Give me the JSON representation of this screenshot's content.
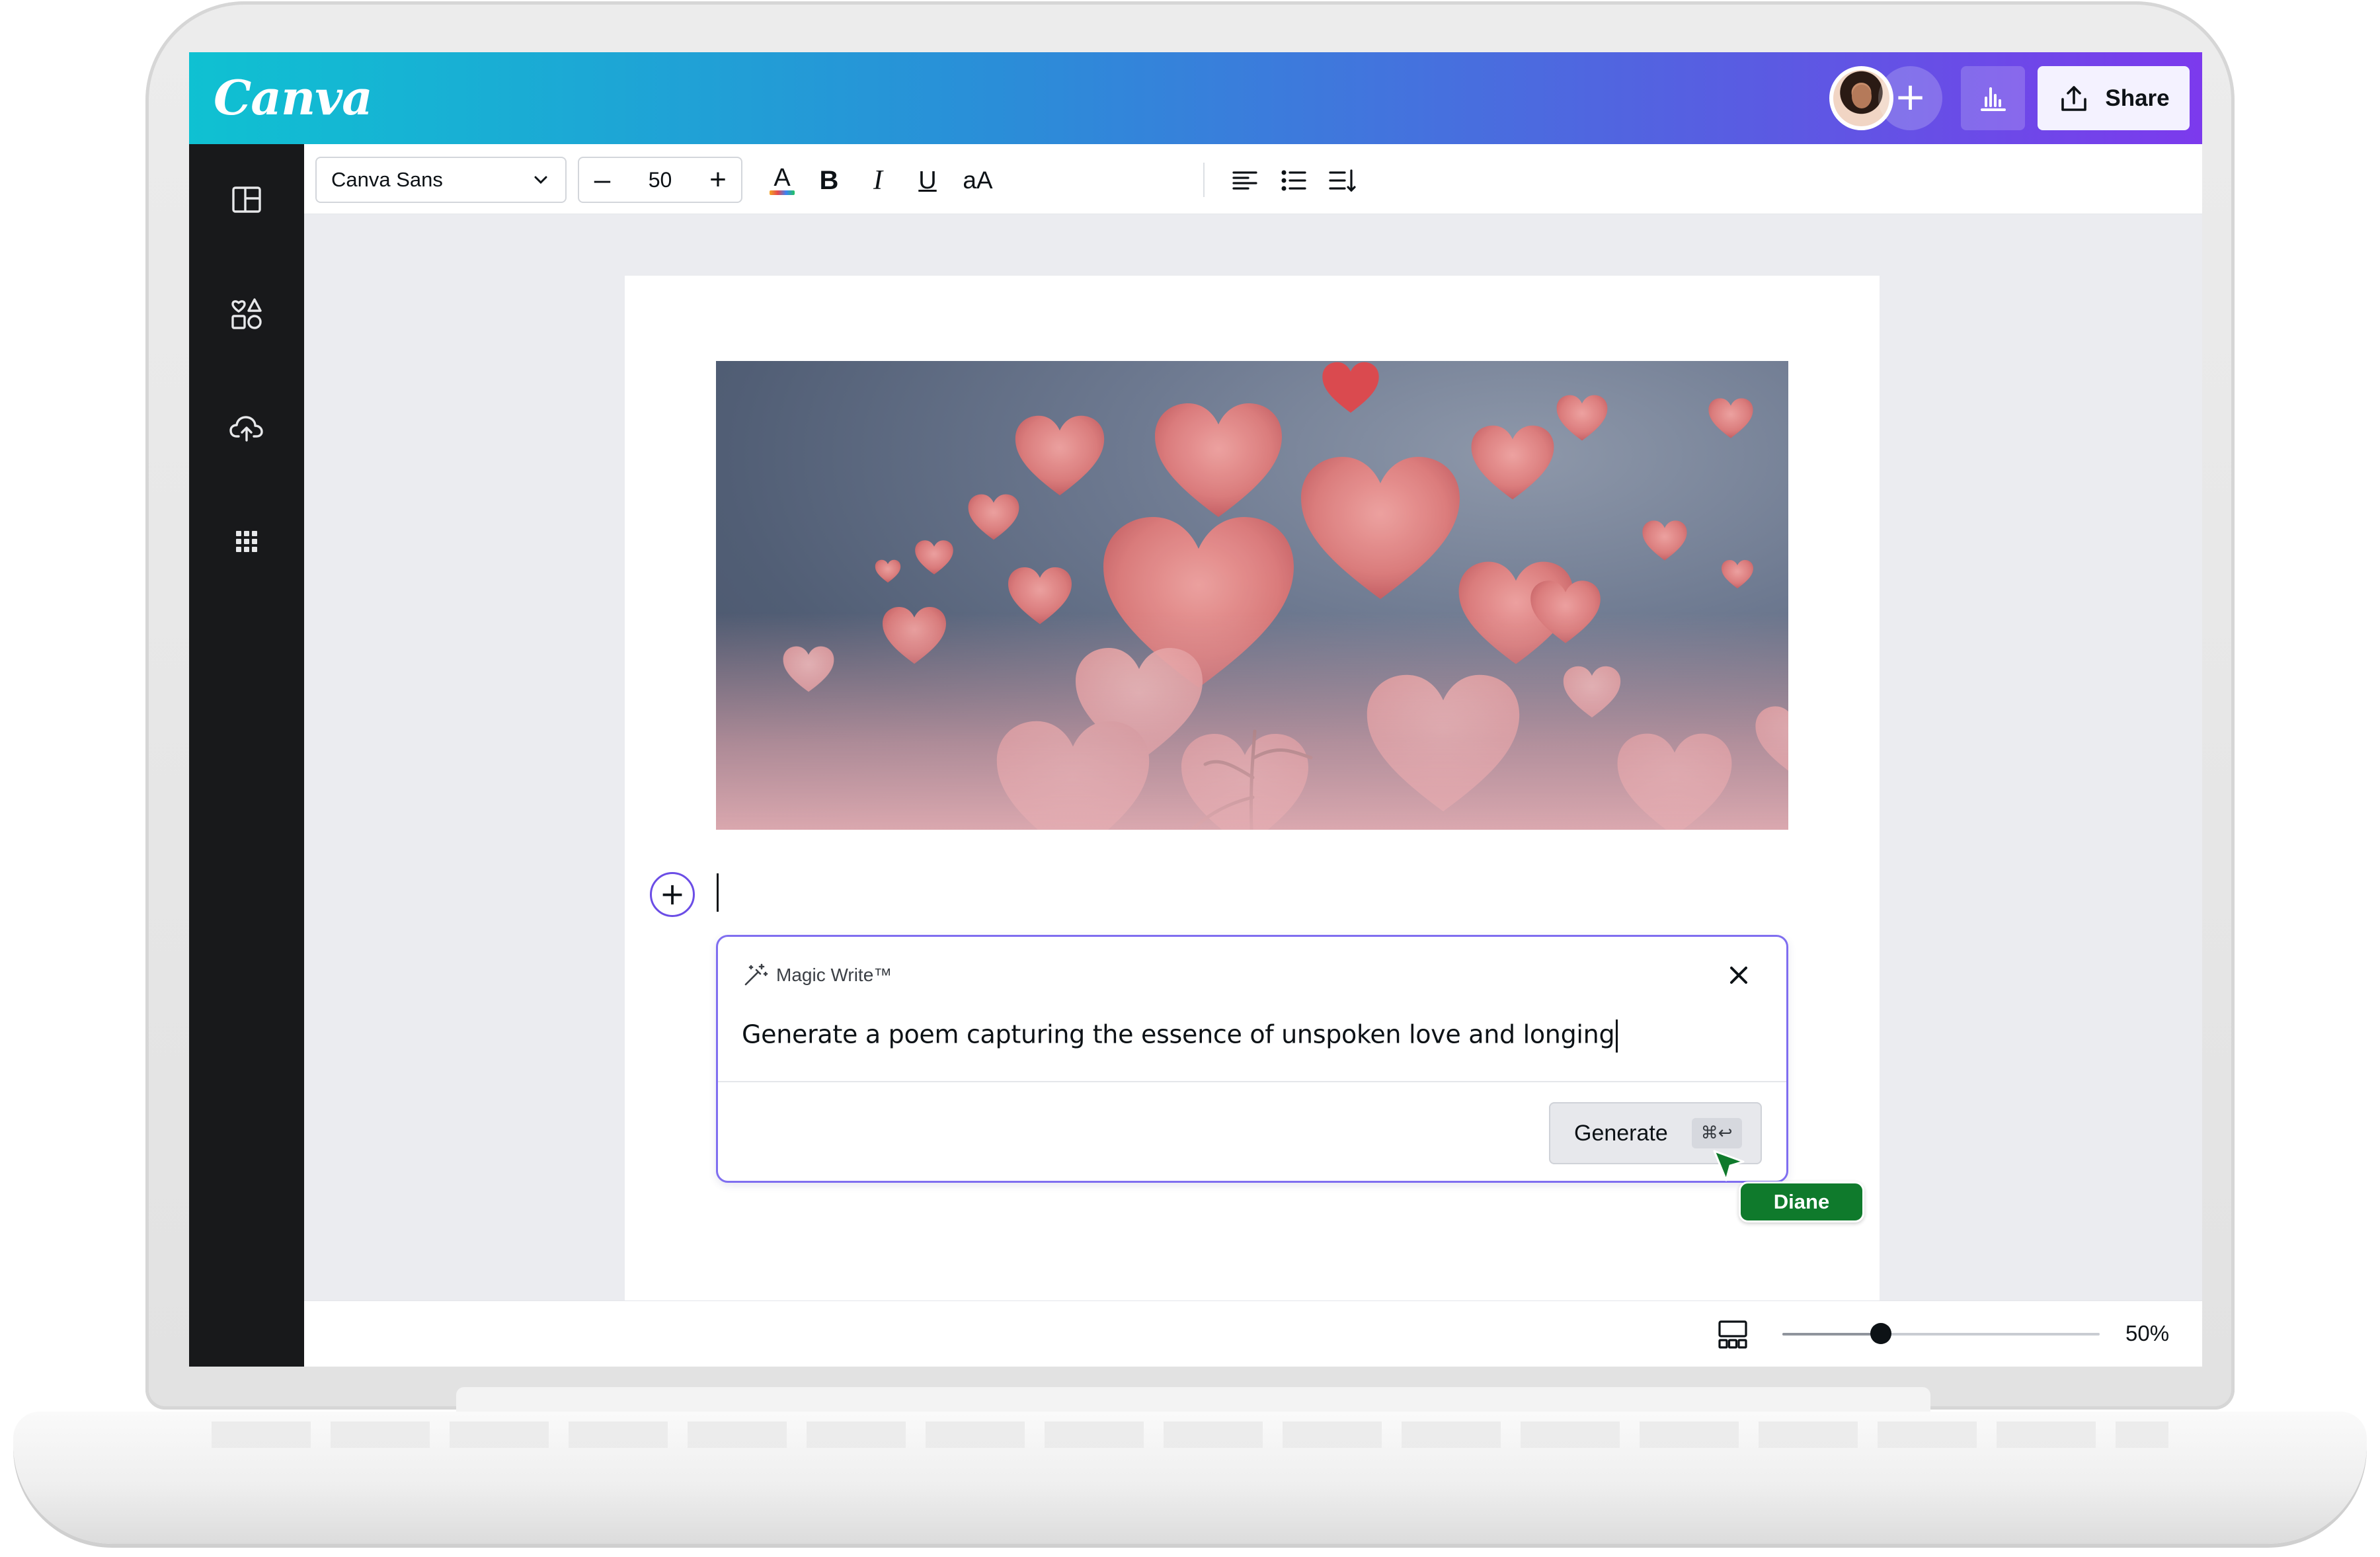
{
  "app": {
    "logo_text": "Canva"
  },
  "topbar": {
    "avatar_icon": "user-avatar",
    "add_icon": "plus-icon",
    "analytics_icon": "bar-chart-icon",
    "share_label": "Share",
    "share_icon": "upload-icon"
  },
  "sidebar": {
    "items": [
      {
        "name": "design",
        "icon": "layout-icon"
      },
      {
        "name": "elements",
        "icon": "shapes-icon"
      },
      {
        "name": "uploads",
        "icon": "cloud-upload-icon"
      },
      {
        "name": "apps",
        "icon": "grid-icon"
      }
    ]
  },
  "toolbar": {
    "font_family": "Canva Sans",
    "font_size": "50",
    "decrease": "–",
    "increase": "+",
    "text_color_glyph": "A",
    "bold_glyph": "B",
    "italic_glyph": "I",
    "underline_glyph": "U",
    "case_glyph": "aA"
  },
  "canvas": {
    "image_subject": "hearts",
    "add_icon": "plus-icon"
  },
  "magic_write": {
    "label": "Magic Write™",
    "prompt": "Generate a poem capturing the essence of unspoken love and longing",
    "generate_label": "Generate",
    "shortcut": "⌘↩",
    "close_icon": "close-icon"
  },
  "collaborator": {
    "name": "Diane",
    "color": "#0f7a2c"
  },
  "footer": {
    "zoom": "50%",
    "zoom_fraction": 0.5
  },
  "colors": {
    "topbar_start": "#0fc1d2",
    "topbar_end": "#7c3aed",
    "sidebar": "#18191b",
    "accent": "#7f6ef0"
  }
}
